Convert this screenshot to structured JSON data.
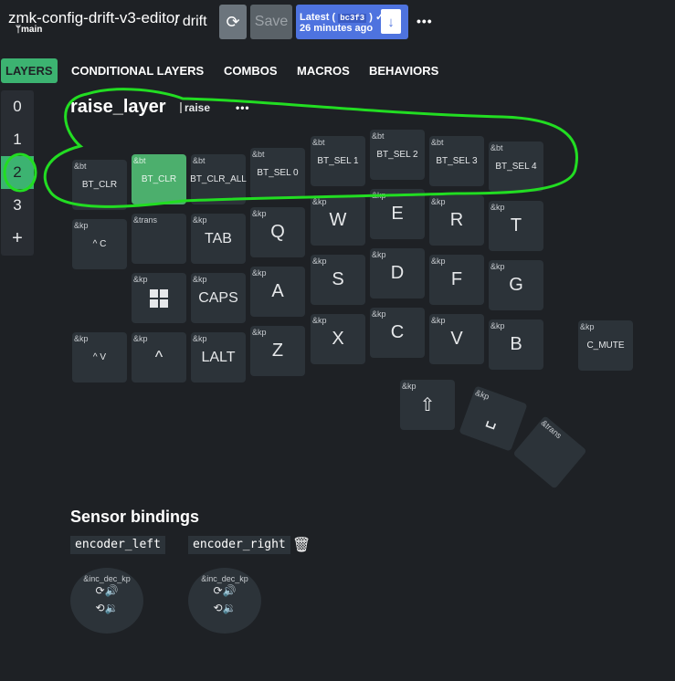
{
  "header": {
    "repo": "zmk-config-drift-v3-editor",
    "branch": "main",
    "keyboard": "/ drift",
    "save_label": "Save",
    "latest_label": "Latest (",
    "latest_hash": "bc3f3",
    "latest_close": ")",
    "latest_time": "26 minutes ago",
    "more_icon": "ellipsis-icon"
  },
  "tabs": [
    "LAYERS",
    "CONDITIONAL LAYERS",
    "COMBOS",
    "MACROS",
    "BEHAVIORS"
  ],
  "layers": [
    "0",
    "1",
    "2",
    "3",
    "+"
  ],
  "layer": {
    "name": "raise_layer",
    "label": "raise",
    "more": "•••"
  },
  "keys": [
    {
      "b": "&bt",
      "p": "BT_CLR",
      "sel": false
    },
    {
      "b": "&bt",
      "p": "BT_CLR",
      "sel": true
    },
    {
      "b": "&bt",
      "p": "BT_CLR_ALL",
      "sel": false
    },
    {
      "b": "&bt",
      "p": "BT_SEL 0",
      "sel": false
    },
    {
      "b": "&bt",
      "p": "BT_SEL 1",
      "sel": false
    },
    {
      "b": "&bt",
      "p": "BT_SEL 2",
      "sel": false
    },
    {
      "b": "&bt",
      "p": "BT_SEL 3",
      "sel": false
    },
    {
      "b": "&bt",
      "p": "BT_SEL 4",
      "sel": false
    },
    {
      "b": "&kp",
      "p": "^ C"
    },
    {
      "b": "&trans",
      "p": ""
    },
    {
      "b": "&kp",
      "p": "TAB"
    },
    {
      "b": "&kp",
      "p": "Q"
    },
    {
      "b": "&kp",
      "p": "W"
    },
    {
      "b": "&kp",
      "p": "E"
    },
    {
      "b": "&kp",
      "p": "R"
    },
    {
      "b": "&kp",
      "p": "T"
    },
    {
      "b": "&kp",
      "p": "windows-logo-icon"
    },
    {
      "b": "&kp",
      "p": "CAPS"
    },
    {
      "b": "&kp",
      "p": "A"
    },
    {
      "b": "&kp",
      "p": "S"
    },
    {
      "b": "&kp",
      "p": "D"
    },
    {
      "b": "&kp",
      "p": "F"
    },
    {
      "b": "&kp",
      "p": "G"
    },
    {
      "b": "&kp",
      "p": "^ V"
    },
    {
      "b": "&kp",
      "p": "^"
    },
    {
      "b": "&kp",
      "p": "LALT"
    },
    {
      "b": "&kp",
      "p": "Z"
    },
    {
      "b": "&kp",
      "p": "X"
    },
    {
      "b": "&kp",
      "p": "C"
    },
    {
      "b": "&kp",
      "p": "V"
    },
    {
      "b": "&kp",
      "p": "B"
    },
    {
      "b": "&kp",
      "p": "C_MUTE"
    },
    {
      "b": "&kp",
      "p": "⇧"
    },
    {
      "b": "&kp",
      "p": "␣"
    },
    {
      "b": "&trans",
      "p": ""
    }
  ],
  "sensors": {
    "title": "Sensor bindings",
    "encoders": [
      {
        "name": "encoder_left",
        "binding": "&inc_dec_kp"
      },
      {
        "name": "encoder_right",
        "binding": "&inc_dec_kp"
      }
    ],
    "delete_icon": "trash-icon"
  },
  "colors": {
    "accent": "#3cb371",
    "primary": "#4e73df",
    "highlight": "#22dd22"
  }
}
